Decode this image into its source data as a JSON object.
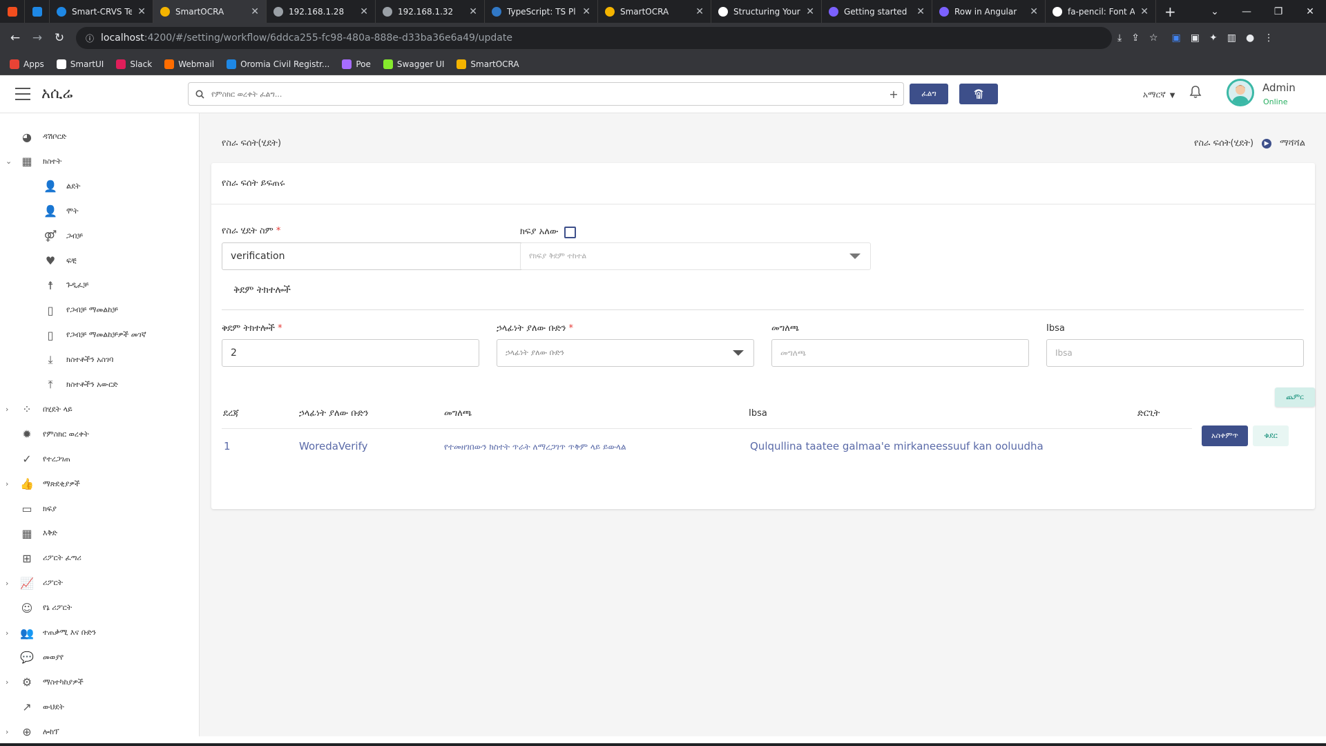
{
  "browser": {
    "tabs": [
      {
        "label": "Smart-CRVS Tea",
        "color": "#1e88e5"
      },
      {
        "label": "SmartOCRA",
        "color": "#f4b400",
        "active": true
      },
      {
        "label": "192.168.1.28",
        "color": "#9aa0a6"
      },
      {
        "label": "192.168.1.32",
        "color": "#9aa0a6"
      },
      {
        "label": "TypeScript: TS Pl",
        "color": "#3178c6"
      },
      {
        "label": "SmartOCRA",
        "color": "#f4b400"
      },
      {
        "label": "Structuring Your",
        "color": "#ffffff"
      },
      {
        "label": "Getting started",
        "color": "#7b61ff"
      },
      {
        "label": "Row in Angular",
        "color": "#7b61ff"
      },
      {
        "label": "fa-pencil: Font A",
        "color": "#ffffff"
      }
    ],
    "url_host": "localhost",
    "url_path": ":4200/#/setting/workflow/6ddca255-fc98-480a-888e-d33ba36e6a49/update",
    "bookmarks": [
      {
        "label": "Apps",
        "color": "#ea4335"
      },
      {
        "label": "SmartUI",
        "color": "#ffffff"
      },
      {
        "label": "Slack",
        "color": "#e01e5a"
      },
      {
        "label": "Webmail",
        "color": "#ff6d00"
      },
      {
        "label": "Oromia Civil Registr...",
        "color": "#1e88e5"
      },
      {
        "label": "Poe",
        "color": "#a66cff"
      },
      {
        "label": "Swagger UI",
        "color": "#85ea2d"
      },
      {
        "label": "SmartOCRA",
        "color": "#f4b400"
      }
    ]
  },
  "header": {
    "brand": "አሲሬ",
    "search_placeholder": "የምስክር ወረቀት ፈልግ...",
    "search_button": "ፈልግ",
    "language": "አማርኛ",
    "user_name": "Admin",
    "user_status": "Online"
  },
  "sidebar": {
    "items": [
      {
        "label": "ዳሽቦርድ",
        "icon": "palette-icon",
        "glyph": "◕",
        "indent": 0,
        "expandable": false
      },
      {
        "label": "ክስተት",
        "icon": "calendar-icon",
        "glyph": "▦",
        "indent": 0,
        "expandable": true,
        "expanded": true
      },
      {
        "label": "ልደት",
        "icon": "user-plus-icon",
        "glyph": "👤",
        "indent": 1,
        "expandable": false
      },
      {
        "label": "ሞት",
        "icon": "user-x-icon",
        "glyph": "👤",
        "indent": 1,
        "expandable": false
      },
      {
        "label": "ጋብቻ",
        "icon": "gender-icon",
        "glyph": "⚤",
        "indent": 1,
        "expandable": false
      },
      {
        "label": "ፍቺ",
        "icon": "heart-broken-icon",
        "glyph": "♥",
        "indent": 1,
        "expandable": false
      },
      {
        "label": "ጉዲፈቻ",
        "icon": "child-icon",
        "glyph": "☨",
        "indent": 1,
        "expandable": false
      },
      {
        "label": "የጋብቻ ማመልከቻ",
        "icon": "file-icon",
        "glyph": "▯",
        "indent": 1,
        "expandable": false
      },
      {
        "label": "የጋብቻ ማመልከቻዎች መገኛ",
        "icon": "file-icon",
        "glyph": "▯",
        "indent": 1,
        "expandable": false
      },
      {
        "label": "ክስተቶችን አስገባ",
        "icon": "download-icon",
        "glyph": "⤓",
        "indent": 1,
        "expandable": false
      },
      {
        "label": "ክስተቶችን አውርድ",
        "icon": "upload-icon",
        "glyph": "⤒",
        "indent": 1,
        "expandable": false
      },
      {
        "label": "በሂደት ላይ",
        "icon": "spinner-icon",
        "glyph": "⁘",
        "indent": 0,
        "expandable": true
      },
      {
        "label": "የምስክር ወረቀት",
        "icon": "certificate-icon",
        "glyph": "✹",
        "indent": 0,
        "expandable": false
      },
      {
        "label": "የተረጋገጠ",
        "icon": "check-circle-icon",
        "glyph": "✓",
        "indent": 0,
        "expandable": false
      },
      {
        "label": "ማጽደቂያዎች",
        "icon": "thumbs-up-icon",
        "glyph": "👍",
        "indent": 0,
        "expandable": true
      },
      {
        "label": "ክፍያ",
        "icon": "credit-card-icon",
        "glyph": "▭",
        "indent": 0,
        "expandable": false
      },
      {
        "label": "እቅድ",
        "icon": "calendar-icon",
        "glyph": "▦",
        "indent": 0,
        "expandable": false
      },
      {
        "label": "ሪፖርት ፈጣሪ",
        "icon": "plus-square-icon",
        "glyph": "⊞",
        "indent": 0,
        "expandable": false
      },
      {
        "label": "ሪፖርት",
        "icon": "chart-line-icon",
        "glyph": "📈",
        "indent": 0,
        "expandable": true
      },
      {
        "label": "የኔ ሪፖርት",
        "icon": "smile-icon",
        "glyph": "☺",
        "indent": 0,
        "expandable": false
      },
      {
        "label": "ተጠቃሚ እና ቡድን",
        "icon": "users-icon",
        "glyph": "👥",
        "indent": 0,
        "expandable": true
      },
      {
        "label": "መወያየ",
        "icon": "comments-icon",
        "glyph": "💬",
        "indent": 0,
        "expandable": false
      },
      {
        "label": "ማስተካከያዎች",
        "icon": "gear-icon",
        "glyph": "⚙",
        "indent": 0,
        "expandable": true
      },
      {
        "label": "ውህደት",
        "icon": "external-link-icon",
        "glyph": "↗",
        "indent": 0,
        "expandable": false
      },
      {
        "label": "ሎከፕ",
        "icon": "circle-icon",
        "glyph": "⊕",
        "indent": 0,
        "expandable": true
      }
    ]
  },
  "page": {
    "title": "የስራ ፍሰት(ሂደት)",
    "crumb_parent": "የስራ ፍሰት(ሂደት)",
    "crumb_current": "ማሻሻል",
    "card_title": "የስራ ፍሰት ይፍጠሩ",
    "workflow_name_label": "የስራ ሂደት ስም",
    "workflow_name_value": "verification",
    "has_payment_label": "ክፍያ አለው",
    "payment_step_placeholder": "የክፍያ ቅደም ተከተል",
    "steps_section_title": "ቅደም ትክተሎች",
    "step_label": "ቅደም ትክተሎች",
    "step_value": "2",
    "group_label": "ኃላፊነት ያለው ቡድን",
    "group_placeholder": "ኃላፊነት ያለው ቡድን",
    "desc_label": "መግለጫ",
    "desc_placeholder": "መግለጫ",
    "ibsa_label": "Ibsa",
    "ibsa_placeholder": "Ibsa",
    "add_button": "ጨምር",
    "table": {
      "headers": [
        "ደረጃ",
        "ኃላፊነት ያለው ቡድን",
        "መግለጫ",
        "Ibsa",
        "ድርጊት"
      ],
      "rows": [
        {
          "level": "1",
          "group": "WoredaVerify",
          "description": "የተመዘገበውን ክስተት ጥራት ለማረጋገጥ ጥቅም ላይ ይውላል",
          "ibsa": "Qulqullina taatee galmaa'e mirkaneessuuf kan ooluudha"
        }
      ]
    },
    "save_button": "አስቀምጥ",
    "back_button": "ቁደር"
  },
  "colors": {
    "primary": "#3d4f8a",
    "accent_teal": "#16907a",
    "danger": "#e53935"
  }
}
